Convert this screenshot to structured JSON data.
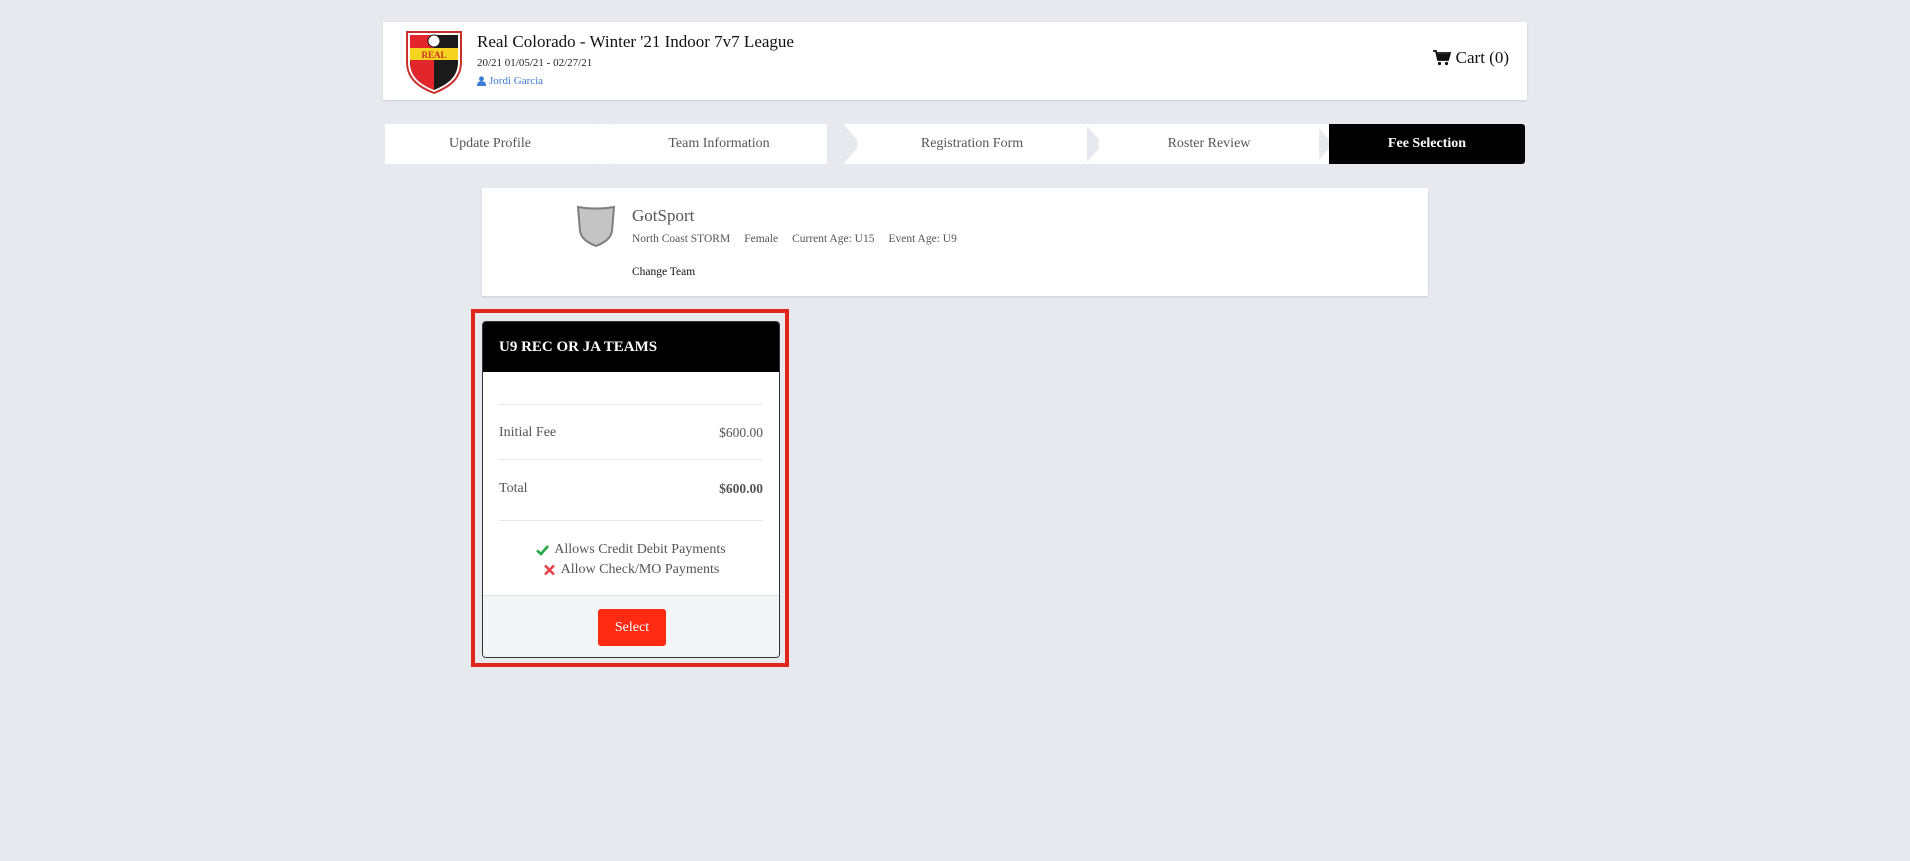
{
  "header": {
    "title": "Real Colorado - Winter '21 Indoor 7v7 League",
    "dates": "20/21 01/05/21 - 02/27/21",
    "user": "Jordi Garcia",
    "logo_text": "REAL",
    "cart_label": "Cart (0)"
  },
  "steps": [
    {
      "label": "Update Profile",
      "active": false
    },
    {
      "label": "Team Information",
      "active": false
    },
    {
      "label": "Registration Form",
      "active": false
    },
    {
      "label": "Roster Review",
      "active": false
    },
    {
      "label": "Fee Selection",
      "active": true
    }
  ],
  "team": {
    "name": "GotSport",
    "club": "North Coast STORM",
    "gender": "Female",
    "current_age": "Current Age: U15",
    "event_age": "Event Age: U9",
    "change_label": "Change Team"
  },
  "fee_card": {
    "title": "U9 REC OR JA TEAMS",
    "rows": [
      {
        "label": "Initial Fee",
        "amount": "$600.00"
      },
      {
        "label": "Total",
        "amount": "$600.00"
      }
    ],
    "payments": [
      {
        "label": "Allows Credit Debit Payments",
        "allowed": true,
        "icon": "check-icon"
      },
      {
        "label": "Allow Check/MO Payments",
        "allowed": false,
        "icon": "x-icon"
      }
    ],
    "select_label": "Select"
  },
  "colors": {
    "background": "#e8e9ef",
    "accent_red": "#ff2a12",
    "highlight_border": "#e0261b",
    "active_step": "#000000",
    "link_blue": "#3a7bd5",
    "check_green": "#28a745",
    "x_red": "#e8414a"
  }
}
